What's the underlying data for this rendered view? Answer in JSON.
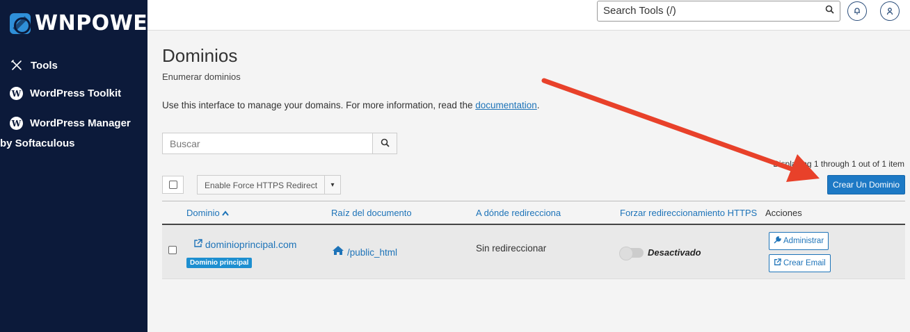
{
  "brand": {
    "name": "WNPOWER"
  },
  "sidebar": {
    "items": [
      {
        "label": "Tools",
        "icon": "tools-icon"
      },
      {
        "label": "WordPress Toolkit",
        "icon": "wordpress-icon"
      },
      {
        "label": "WordPress Manager",
        "icon": "wordpress-icon"
      }
    ],
    "sub_label": "by Softaculous"
  },
  "topbar": {
    "search_placeholder": "Search Tools (/)",
    "icons": [
      "search-icon",
      "bell-icon",
      "user-icon"
    ]
  },
  "page": {
    "title": "Dominios",
    "subtitle": "Enumerar dominios",
    "intro_text": "Use this interface to manage your domains. For more information, read the",
    "intro_link": "documentation",
    "intro_end": "."
  },
  "search": {
    "placeholder": "Buscar"
  },
  "pagination": {
    "text": "Displaying 1 through 1 out of 1 item"
  },
  "bulk_action": {
    "label": "Enable Force HTTPS Redirect"
  },
  "create_button": {
    "label": "Crear Un Dominio"
  },
  "table": {
    "columns": [
      {
        "label": "Dominio",
        "sort": "asc"
      },
      {
        "label": "Raíz del documento"
      },
      {
        "label": "A dónde redirecciona"
      },
      {
        "label": "Forzar redireccionamiento HTTPS"
      },
      {
        "label": "Acciones"
      }
    ],
    "rows": [
      {
        "domain": "dominioprincipal.com",
        "badge": "Dominio principal",
        "docroot": "/public_html",
        "redirect": "Sin redireccionar",
        "https_status": "Desactivado",
        "https_enabled": false,
        "actions": [
          "Administrar",
          "Crear Email"
        ]
      }
    ]
  },
  "colors": {
    "sidebar_bg": "#0c1a3a",
    "accent": "#1d79c5",
    "badge": "#1d8fd0",
    "annotation_arrow": "#e8412a"
  }
}
